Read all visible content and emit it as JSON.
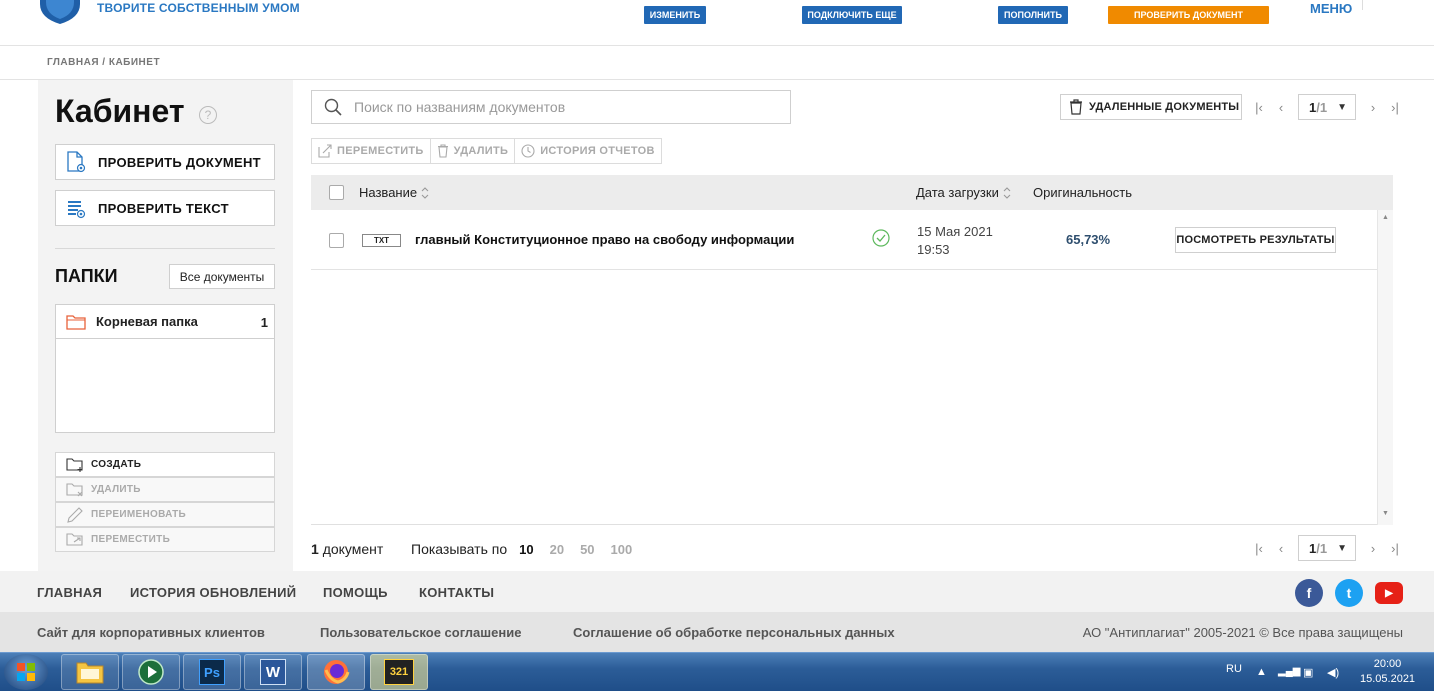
{
  "header": {
    "slogan": "ТВОРИТЕ СОБСТВЕННЫМ УМОМ",
    "buttons": [
      {
        "label": "ИЗМЕНИТЬ",
        "color": "#2168b5"
      },
      {
        "label": "ПОДКЛЮЧИТЬ ЕЩЕ",
        "color": "#2168b5"
      },
      {
        "label": "ПОПОЛНИТЬ",
        "color": "#2168b5"
      },
      {
        "label": "ПРОВЕРИТЬ ДОКУМЕНТ",
        "color": "#f08a00"
      }
    ],
    "menu_label": "МЕНЮ"
  },
  "breadcrumb": "ГЛАВНАЯ / КАБИНЕТ",
  "sidebar": {
    "title": "Кабинет",
    "help_glyph": "?",
    "check_document": "ПРОВЕРИТЬ ДОКУМЕНТ",
    "check_text": "ПРОВЕРИТЬ ТЕКСТ",
    "folders_title": "ПАПКИ",
    "all_documents": "Все документы",
    "folder": {
      "name": "Корневая папка",
      "count": "1"
    },
    "folder_actions": [
      "СОЗДАТЬ",
      "УДАЛИТЬ",
      "ПЕРЕИМЕНОВАТЬ",
      "ПЕРЕМЕСТИТЬ"
    ]
  },
  "main": {
    "search_placeholder": "Поиск по названиям документов",
    "deleted_docs": "УДАЛЕННЫЕ ДОКУМЕНТЫ",
    "pager": {
      "current": "1",
      "total": "/1"
    },
    "toolbar": [
      "ПЕРЕМЕСТИТЬ",
      "УДАЛИТЬ",
      "ИСТОРИЯ ОТЧЕТОВ"
    ],
    "columns": {
      "name": "Название",
      "date": "Дата загрузки",
      "originality": "Оригинальность"
    },
    "rows": [
      {
        "type": "TXT",
        "name": "главный Конституционное право на свободу информации",
        "date": "15 Мая 2021",
        "time": "19:53",
        "originality": "65,73%",
        "action": "ПОСМОТРЕТЬ РЕЗУЛЬТАТЫ"
      }
    ],
    "doc_count_num": "1",
    "doc_count_label": "документ",
    "show_per_label": "Показывать по",
    "per_page": [
      "10",
      "20",
      "50",
      "100"
    ]
  },
  "footer": {
    "nav": [
      "ГЛАВНАЯ",
      "ИСТОРИЯ ОБНОВЛЕНИЙ",
      "ПОМОЩЬ",
      "КОНТАКТЫ"
    ],
    "links": [
      "Сайт для корпоративных клиентов",
      "Пользовательское соглашение",
      "Соглашение об обработке персональных данных"
    ],
    "copyright": "АО \"Антиплагиат\" 2005-2021 © Все права защищены",
    "social": [
      {
        "icon": "facebook-icon",
        "glyph": "f",
        "color": "#3b5998"
      },
      {
        "icon": "twitter-icon",
        "glyph": "t",
        "color": "#1da1f2"
      },
      {
        "icon": "youtube-icon",
        "glyph": "▶",
        "color": "#e62117"
      }
    ]
  },
  "taskbar": {
    "lang": "RU",
    "time": "20:00",
    "date": "15.05.2021",
    "apps": [
      {
        "name": "explorer-icon",
        "glyph": "▤"
      },
      {
        "name": "media-player-icon",
        "glyph": "▶"
      },
      {
        "name": "photoshop-icon",
        "glyph": "Ps"
      },
      {
        "name": "word-icon",
        "glyph": "W"
      },
      {
        "name": "firefox-icon",
        "glyph": "◉"
      },
      {
        "name": "media-classic-icon",
        "glyph": "321"
      }
    ]
  }
}
